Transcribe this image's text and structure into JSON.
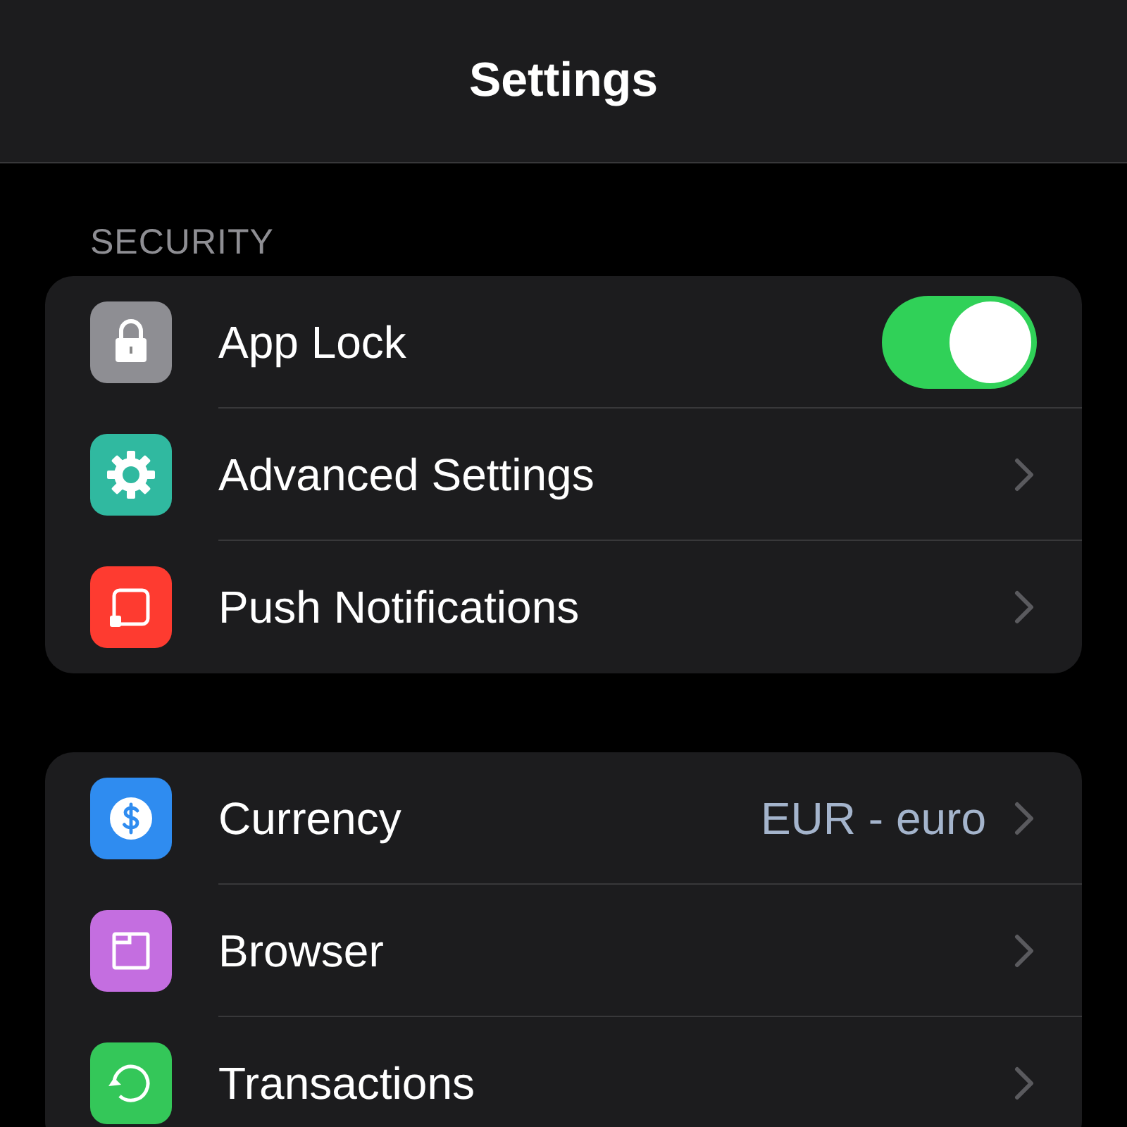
{
  "header": {
    "title": "Settings"
  },
  "sections": [
    {
      "heading": "SECURITY",
      "rows": [
        {
          "kind": "toggle",
          "label": "App Lock",
          "on": true,
          "color": "#8e8e93"
        },
        {
          "kind": "link",
          "label": "Advanced Settings",
          "color": "#30b9a0"
        },
        {
          "kind": "link",
          "label": "Push Notifications",
          "color": "#fe3b30"
        }
      ]
    },
    {
      "rows": [
        {
          "kind": "link",
          "label": "Currency",
          "value": "EUR - euro",
          "color": "#2f8cf0"
        },
        {
          "kind": "link",
          "label": "Browser",
          "color": "#c46ee0"
        },
        {
          "kind": "link",
          "label": "Transactions",
          "color": "#34c759"
        }
      ]
    }
  ]
}
